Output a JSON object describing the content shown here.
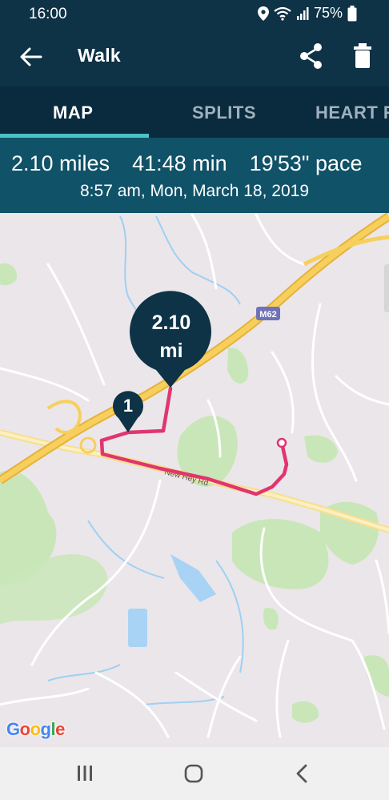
{
  "status_bar": {
    "time": "16:00",
    "battery": "75%"
  },
  "app_bar": {
    "title": "Walk"
  },
  "tabs": [
    {
      "label": "MAP",
      "active": true
    },
    {
      "label": "SPLITS",
      "active": false
    },
    {
      "label": "HEART R",
      "active": false
    }
  ],
  "summary": {
    "distance": "2.10 miles",
    "duration": "41:48 min",
    "pace": "19'53\" pace",
    "date": "8:57 am, Mon, March 18, 2019"
  },
  "map": {
    "motorway_label": "M62",
    "road_label": "New Hey Rd",
    "split_marker": "1",
    "distance_marker_value": "2.10",
    "distance_marker_unit": "mi",
    "provider": "Google"
  },
  "colors": {
    "header": "#0e3246",
    "tabs_bg": "#0a2a3d",
    "summary_bg": "#105268",
    "tab_indicator": "#4cc2c4",
    "route": "#e0356e",
    "marker": "#0e3246",
    "motorway": "#f5c74a",
    "park": "#c7e6b4",
    "water": "#a8d3f5"
  }
}
